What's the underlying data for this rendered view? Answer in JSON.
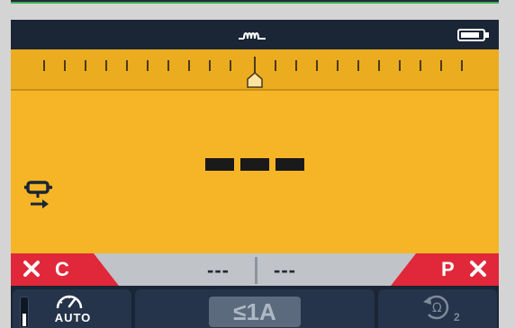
{
  "status": {
    "mode_icon": "inductor-coil-icon",
    "battery_icon": "battery-icon"
  },
  "display": {
    "main_reading": "---",
    "mode_indicator_icon": "test-lead-arrow-icon",
    "scale_pointer_icon": "pentagon-pointer-icon"
  },
  "lower_band": {
    "left_label": "C",
    "right_label": "P",
    "left_close_icon": "close-icon",
    "right_close_icon": "close-icon",
    "value_left": "---",
    "value_right": "---"
  },
  "softkeys": {
    "auto": {
      "label": "AUTO",
      "icon": "gauge-icon",
      "level_indicator_icon": "level-bar-icon"
    },
    "current": {
      "label": "≤1A"
    },
    "rotate": {
      "icon": "rotate-ohm-icon",
      "symbol": "Ω",
      "subscript": "2"
    }
  },
  "colors": {
    "screen_bg": "#f5b526",
    "frame": "#1a2535",
    "alert_red": "#e0283a",
    "lower_band": "#c0c3c7"
  }
}
